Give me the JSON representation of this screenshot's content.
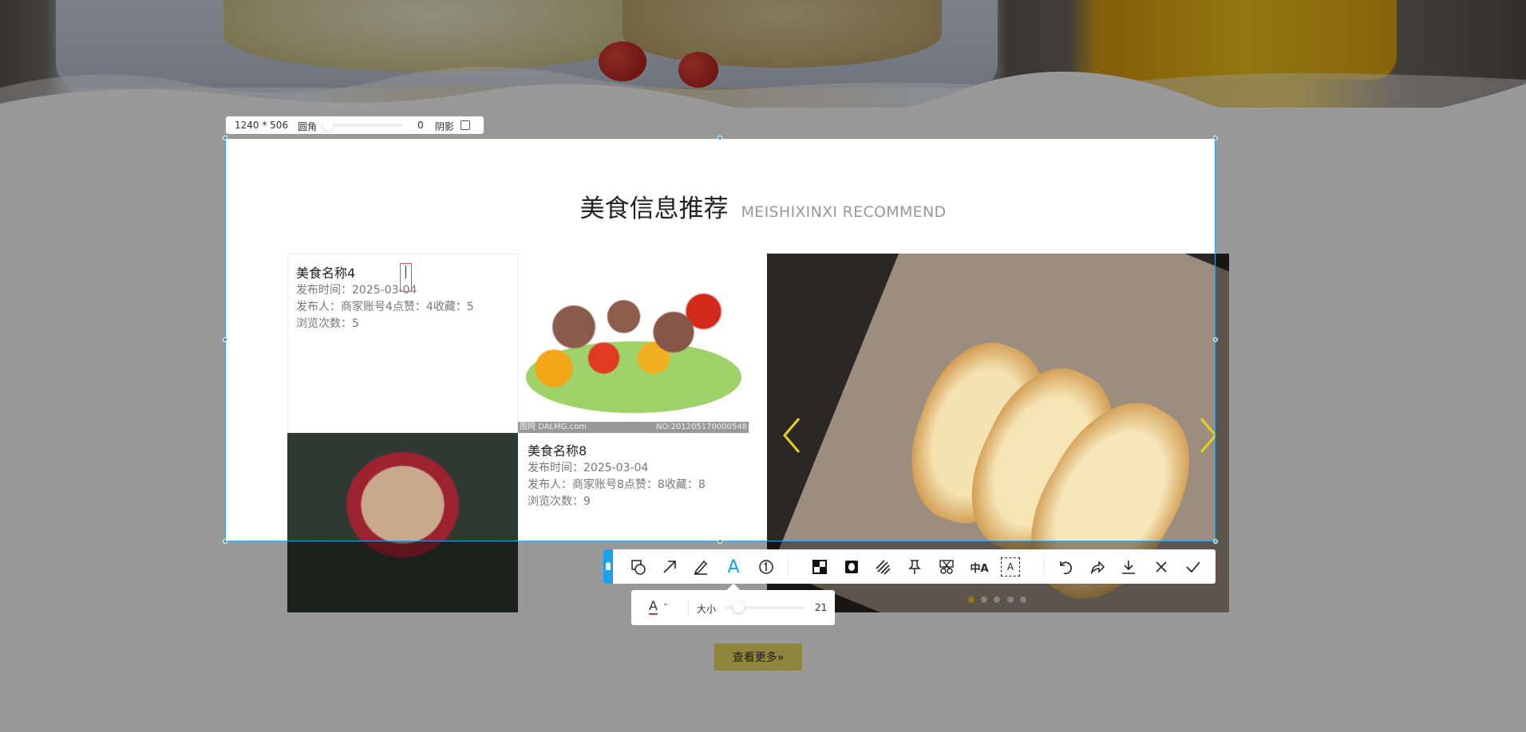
{
  "screenshot_tool": {
    "size_label": "1240 * 506",
    "corner_label": "圆角",
    "corner_value": "0",
    "shadow_label": "阴影",
    "shadow_checked": false,
    "toolbar": [
      {
        "icon": "pin-left-tab-icon"
      },
      {
        "icon": "shape-icon"
      },
      {
        "icon": "arrow-icon"
      },
      {
        "icon": "pen-icon"
      },
      {
        "icon": "text-icon",
        "active": true
      },
      {
        "icon": "number-icon"
      },
      {
        "icon": "mosaic-icon"
      },
      {
        "icon": "blur-icon"
      },
      {
        "icon": "hatch-icon"
      },
      {
        "icon": "pin-icon"
      },
      {
        "icon": "cut-icon"
      },
      {
        "icon": "translate-icon"
      },
      {
        "icon": "ocr-icon"
      },
      {
        "icon": "undo-icon"
      },
      {
        "icon": "redo-icon"
      },
      {
        "icon": "download-icon"
      },
      {
        "icon": "close-icon"
      },
      {
        "icon": "confirm-icon"
      }
    ],
    "text_popup": {
      "color_label": "A",
      "size_label": "大小",
      "size_value": "21",
      "size_fraction": 0.1,
      "text_color": "#d0306a"
    },
    "accent": "#1aa0f0",
    "selection_color": "#3a9fd8"
  },
  "section": {
    "title": "美食信息推荐",
    "subtitle": "MEISHIXINXI RECOMMEND"
  },
  "cards": [
    {
      "name": "美食名称4",
      "time": "发布时间：2025-03-04",
      "meta": "发布人：商家账号4点赞：4收藏：5",
      "views": "浏览次数：5"
    },
    {
      "name": "美食名称8",
      "time": "发布时间：2025-03-04",
      "meta": "发布人：商家账号8点赞：8收藏：8",
      "views": "浏览次数：9"
    }
  ],
  "kebab_watermark": {
    "left": "图网 DALMG.com",
    "right": "NO:20120517000054​8"
  },
  "carousel": {
    "dots": 5,
    "active_dot": 0,
    "arrow_color": "#e8d020"
  },
  "more_button": "查看更多»",
  "colors": {
    "more_button": "#eedf67"
  }
}
